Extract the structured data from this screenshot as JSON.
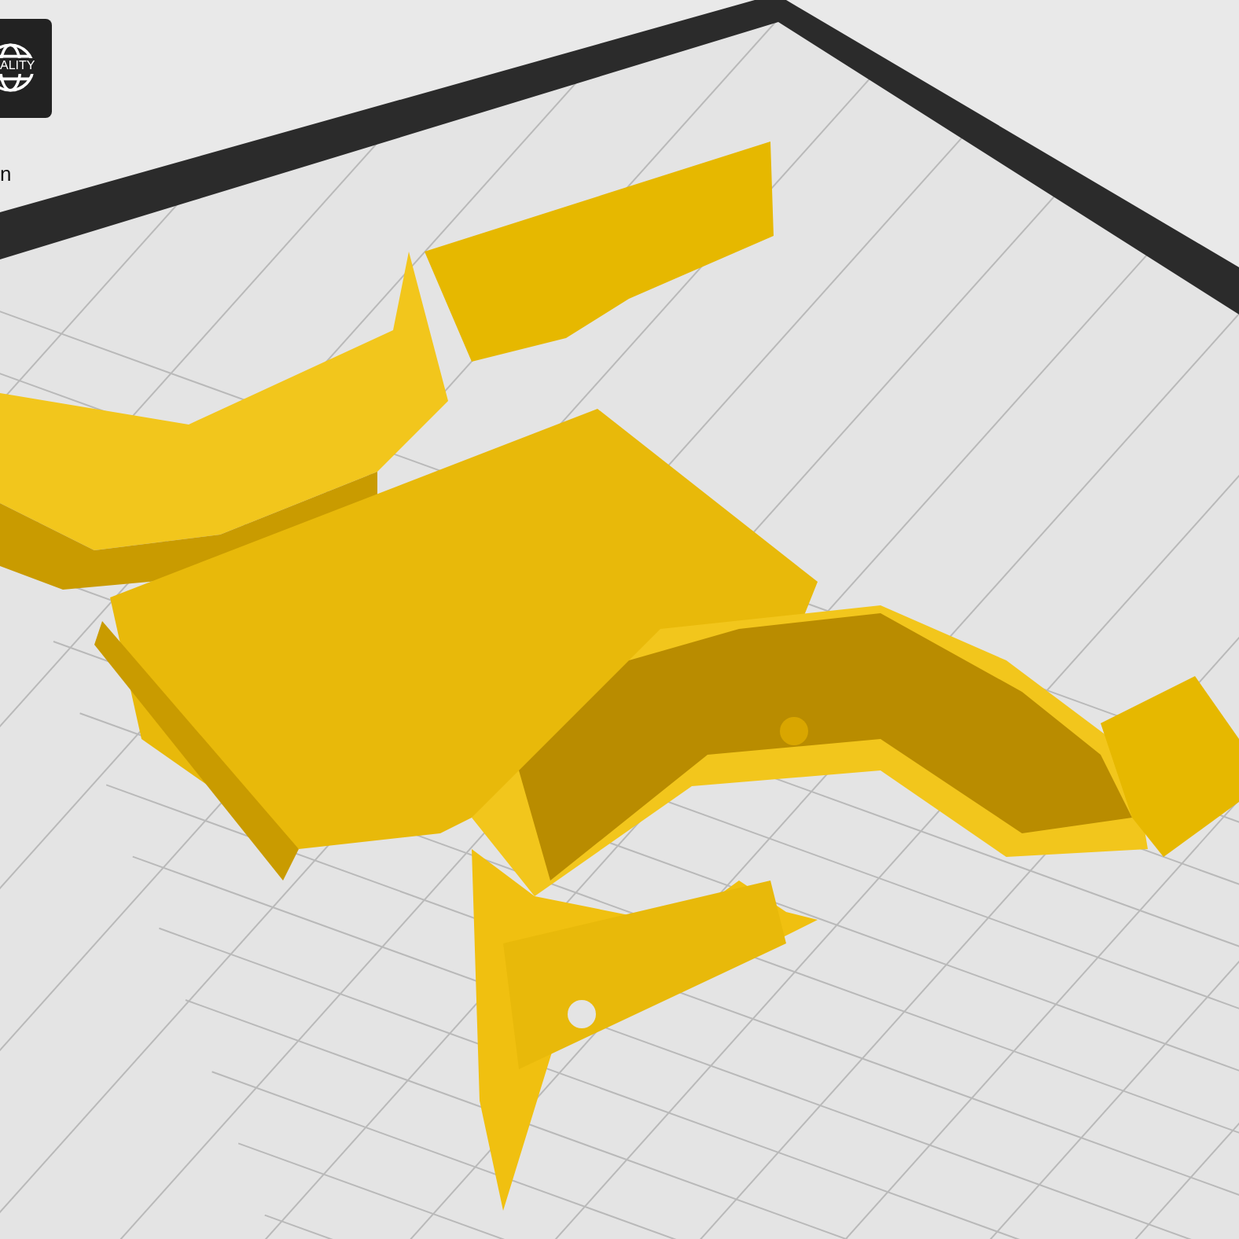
{
  "logo": {
    "text": "ALITY"
  },
  "corner_label": "n"
}
